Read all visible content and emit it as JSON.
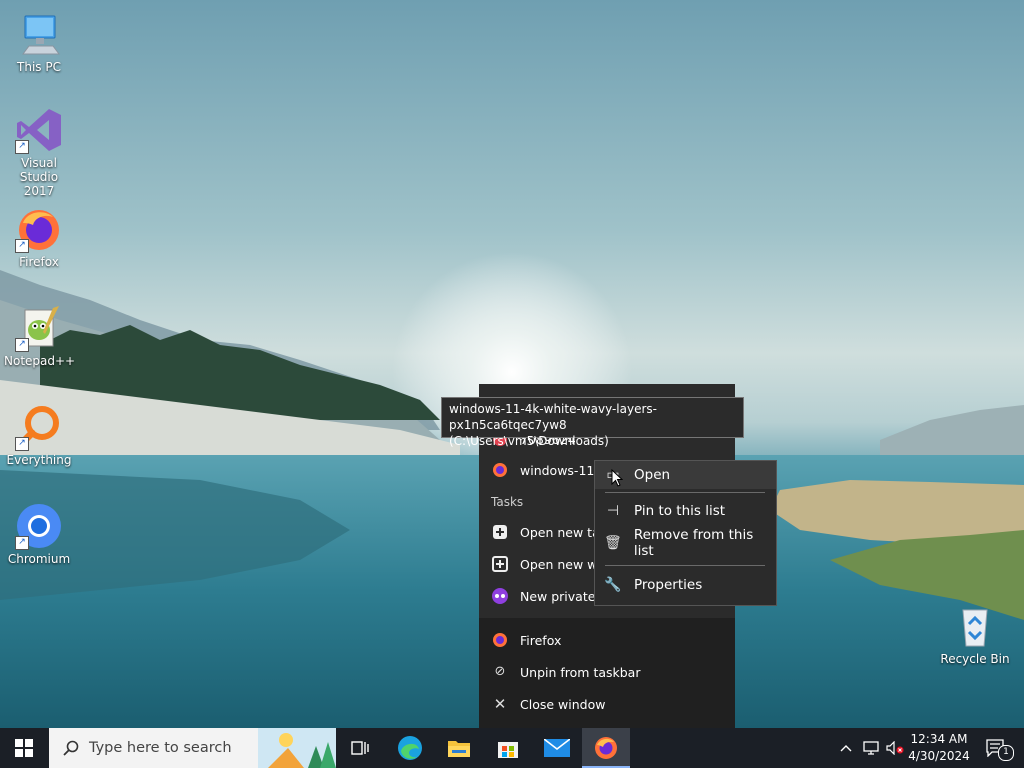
{
  "desktop": {
    "icons": [
      {
        "label": "This PC"
      },
      {
        "label": "Visual Studio 2017"
      },
      {
        "label": "Firefox"
      },
      {
        "label": "Notepad++"
      },
      {
        "label": "Everything"
      },
      {
        "label": "Chromium"
      },
      {
        "label": "Recycle Bin"
      }
    ]
  },
  "jumplist": {
    "recent_partial": "7089624",
    "recent_item": "windows-11-4",
    "tasks_header": "Tasks",
    "tasks": [
      {
        "label": "Open new tab"
      },
      {
        "label": "Open new window"
      },
      {
        "label": "New private window"
      }
    ],
    "app_name": "Firefox",
    "unpin": "Unpin from taskbar",
    "close": "Close window"
  },
  "tooltip": {
    "line1": "windows-11-4k-white-wavy-layers-px1n5ca6tqec7yw8",
    "line2": "(C:\\Users\\vm5\\Downloads)"
  },
  "context_menu": {
    "items": [
      {
        "label": "Open"
      },
      {
        "label": "Pin to this list"
      },
      {
        "label": "Remove from this list"
      },
      {
        "label": "Properties"
      }
    ]
  },
  "taskbar": {
    "search_placeholder": "Type here to search",
    "time": "12:34 AM",
    "date": "4/30/2024",
    "notification_count": "1"
  },
  "colors": {
    "menu_bg": "#2b2b2b",
    "taskbar_bg": "#1b1f26",
    "active_indicator": "#8ab4f8"
  }
}
